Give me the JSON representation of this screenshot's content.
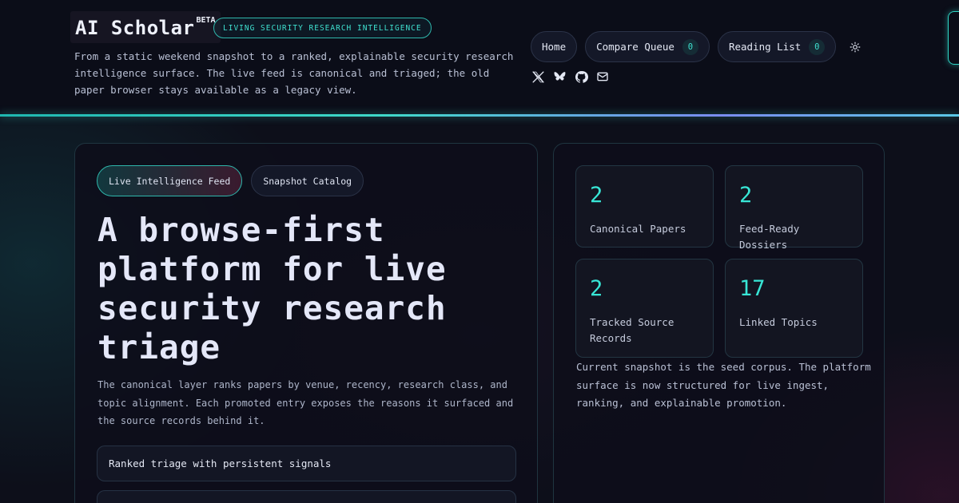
{
  "brand": {
    "name": "AI Scholar",
    "badge": "BETA"
  },
  "tagline": "LIVING SECURITY RESEARCH INTELLIGENCE",
  "intro": "From a static weekend snapshot to a ranked, explainable security research intelligence surface. The live feed is canonical and triaged; the old paper browser stays available as a legacy view.",
  "nav": {
    "home": "Home",
    "compare_queue": {
      "label": "Compare Queue",
      "count": "0"
    },
    "reading_list": {
      "label": "Reading List",
      "count": "0"
    },
    "theme_icon": "sun-icon"
  },
  "socials": [
    "x-icon",
    "bluesky-icon",
    "github-icon",
    "mail-icon"
  ],
  "colors": {
    "accent": "#38e6d6",
    "background": "#0d0f1a",
    "border": "#1f3540"
  },
  "hero": {
    "tabs": [
      "Live Intelligence Feed",
      "Snapshot Catalog"
    ],
    "title": "A browse-first platform for live security research triage",
    "body": "The canonical layer ranks papers by venue, recency, research class, and topic alignment. Each promoted entry exposes the reasons it surfaced and the source records behind it.",
    "features": [
      "Ranked triage with persistent signals",
      ""
    ]
  },
  "stats": [
    {
      "value": "2",
      "label": "Canonical Papers"
    },
    {
      "value": "2",
      "label": "Feed-Ready Dossiers"
    },
    {
      "value": "2",
      "label": "Tracked Source Records"
    },
    {
      "value": "17",
      "label": "Linked Topics"
    }
  ],
  "snapshot_note": "Current snapshot is the seed corpus. The platform surface is now structured for live ingest, ranking, and explainable promotion."
}
